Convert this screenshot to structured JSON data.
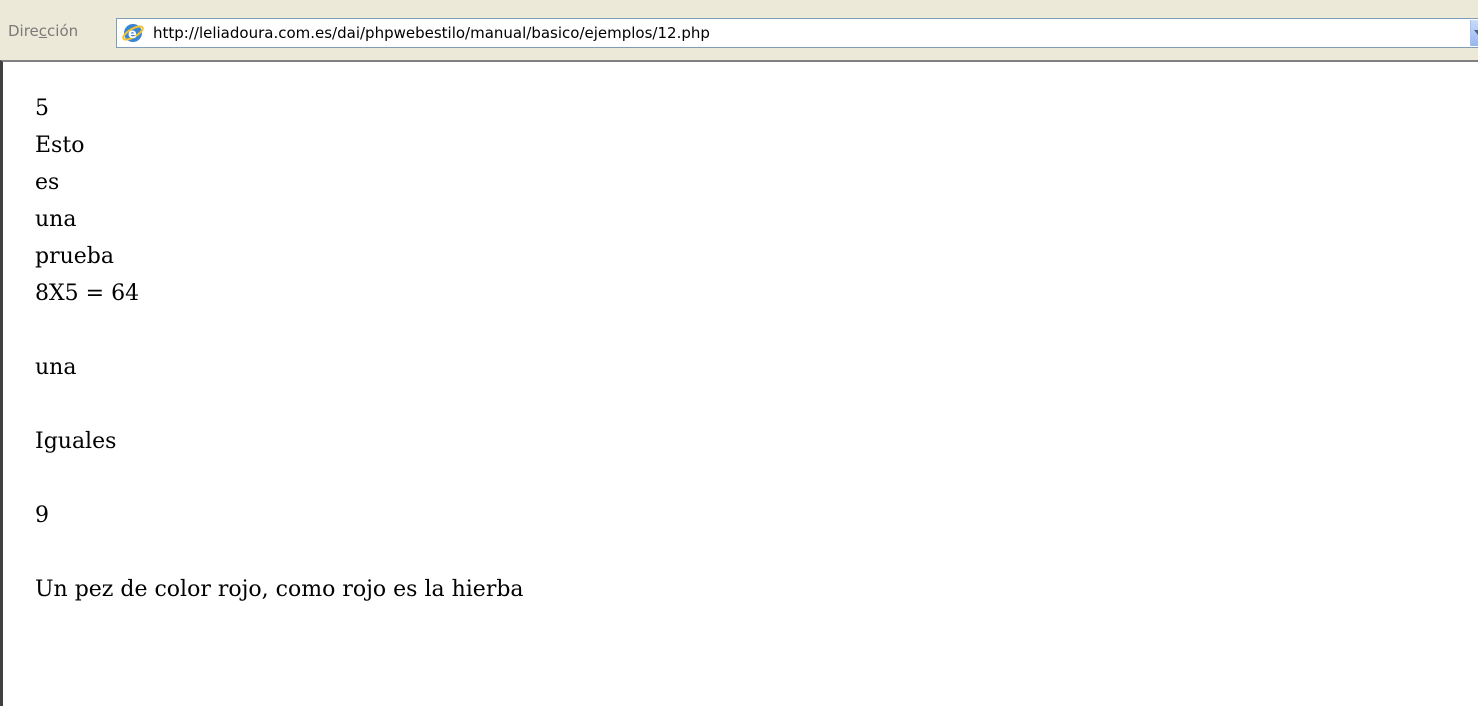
{
  "address_bar": {
    "label": "Dirección",
    "url": "http://leliadoura.com.es/dai/phpwebestilo/manual/basico/ejemplos/12.php"
  },
  "page": {
    "lines": [
      "5",
      "Esto",
      "es",
      "una",
      "prueba",
      "8X5 = 64"
    ],
    "line_una": "una",
    "line_iguales": "Iguales",
    "line_nueve": "9",
    "line_sentence": "Un pez de color rojo, como rojo es la hierba"
  },
  "icons": {
    "address_icon": "internet-explorer-icon",
    "dropdown": "chevron-down-icon"
  }
}
